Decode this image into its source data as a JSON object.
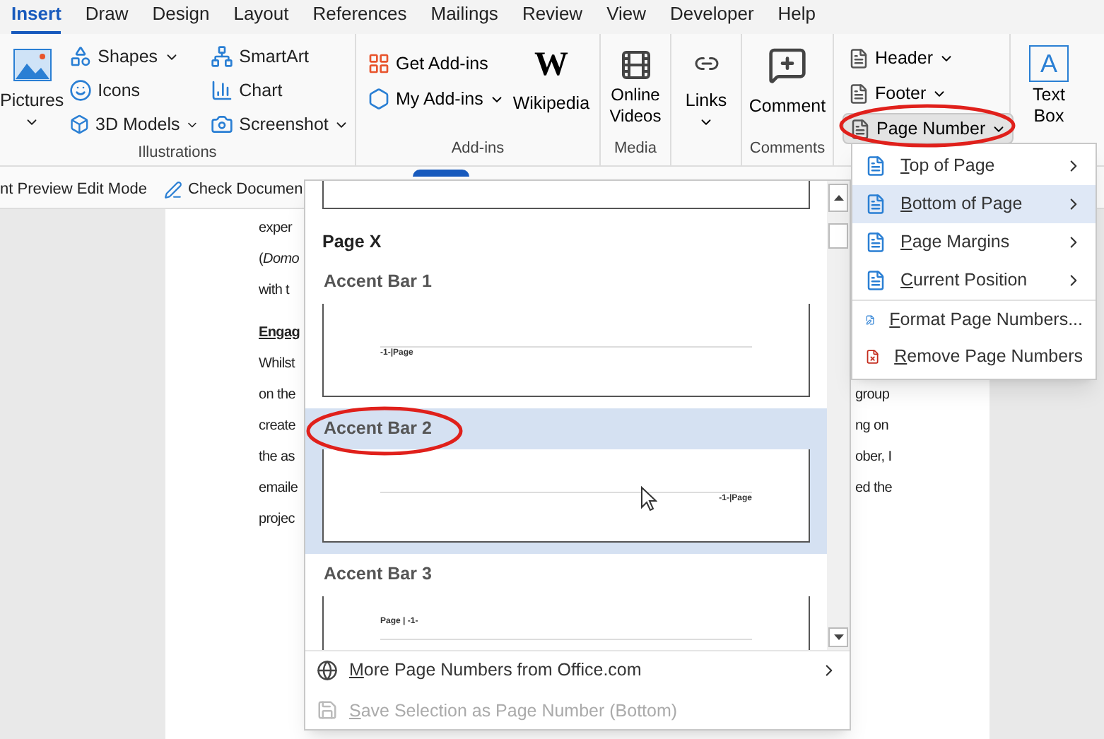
{
  "tabs": [
    {
      "label": "Insert",
      "selected": true
    },
    {
      "label": "Draw",
      "selected": false
    },
    {
      "label": "Design",
      "selected": false
    },
    {
      "label": "Layout",
      "selected": false
    },
    {
      "label": "References",
      "selected": false
    },
    {
      "label": "Mailings",
      "selected": false
    },
    {
      "label": "Review",
      "selected": false
    },
    {
      "label": "View",
      "selected": false
    },
    {
      "label": "Developer",
      "selected": false
    },
    {
      "label": "Help",
      "selected": false
    }
  ],
  "ribbon": {
    "illustrations": {
      "label": "Illustrations",
      "pictures": "Pictures",
      "small": [
        {
          "label": "Shapes",
          "dropdown": true
        },
        {
          "label": "Icons",
          "dropdown": false
        },
        {
          "label": "3D Models",
          "dropdown": true
        },
        {
          "label": "SmartArt",
          "dropdown": false
        },
        {
          "label": "Chart",
          "dropdown": false
        },
        {
          "label": "Screenshot",
          "dropdown": true
        }
      ]
    },
    "addins": {
      "label": "Add-ins",
      "get": "Get Add-ins",
      "my": "My Add-ins",
      "wiki_logo": "W",
      "wiki": "Wikipedia"
    },
    "media": {
      "label": "Media",
      "online_videos": "Online Videos"
    },
    "links": {
      "label": "Links"
    },
    "comments": {
      "label": "Comments",
      "comment": "Comment"
    },
    "header_footer": [
      {
        "label": "Header"
      },
      {
        "label": "Footer"
      },
      {
        "label": "Page Number"
      }
    ],
    "text": {
      "icon_letter": "A",
      "text_box": "Text Box"
    }
  },
  "message_bar": {
    "mode": "nt Preview Edit Mode",
    "check": "Check Documen",
    "toggle_on": true
  },
  "doc_lines": [
    {
      "kind": "normal",
      "left": "exper"
    },
    {
      "kind": "normal",
      "left": "(*Domo*"
    },
    {
      "kind": "normal",
      "left": "with t"
    },
    {
      "kind": "heading",
      "left": "Engag"
    },
    {
      "kind": "normal",
      "left": "Whilst"
    },
    {
      "kind": "normal",
      "left": "on the",
      "right": "group"
    },
    {
      "kind": "normal",
      "left": "create",
      "right": "ng on"
    },
    {
      "kind": "normal",
      "left": "the as",
      "right": "ober, I"
    },
    {
      "kind": "normal",
      "left": "emaile",
      "right": "ed the"
    },
    {
      "kind": "normal",
      "left": "projec"
    }
  ],
  "gallery": {
    "section": "Page X",
    "items": [
      {
        "label": "Accent Bar 1",
        "sample": "-1-|Page",
        "kind": "start",
        "selected": false
      },
      {
        "label": "Accent Bar 2",
        "sample": "-1-|Page",
        "kind": "end",
        "selected": true
      },
      {
        "label": "Accent Bar 3",
        "sample": "Page | -1-",
        "kind": "start",
        "selected": false
      }
    ],
    "footer": [
      {
        "label": "More Page Numbers from Office.com",
        "disabled": false,
        "submenu": true
      },
      {
        "label": "Save Selection as Page Number (Bottom)",
        "disabled": true,
        "submenu": false
      }
    ]
  },
  "page_number_menu": [
    {
      "label": "Top of Page",
      "submenu": true,
      "selected": false
    },
    {
      "label": "Bottom of Page",
      "submenu": true,
      "selected": true
    },
    {
      "label": "Page Margins",
      "submenu": true,
      "selected": false
    },
    {
      "label": "Current Position",
      "submenu": true,
      "selected": false
    },
    {
      "label": "Format Page Numbers...",
      "submenu": false,
      "selected": false
    },
    {
      "label": "Remove Page Numbers",
      "submenu": false,
      "selected": false
    }
  ]
}
